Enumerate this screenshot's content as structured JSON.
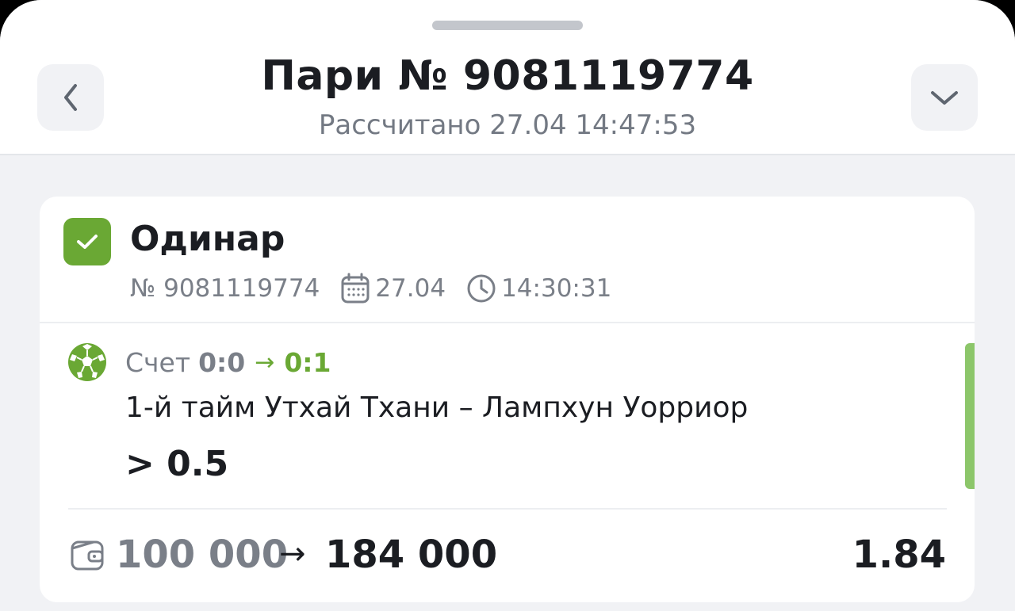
{
  "header": {
    "title": "Пари № 9081119774",
    "subtitle": "Рассчитано 27.04 14:47:53"
  },
  "bet": {
    "type": "Одинар",
    "number": "№ 9081119774",
    "date": "27.04",
    "time": "14:30:31",
    "status_icon": "check-icon",
    "accent_color": "#6aa834"
  },
  "event": {
    "sport_icon": "soccer-ball-icon",
    "score_label": "Счет",
    "score_from": "0:0",
    "score_arrow": "→",
    "score_to": "0:1",
    "name": "1-й тайм Утхай Тхани – Лампхун Уорриор",
    "outcome": "> 0.5"
  },
  "summary": {
    "stake": "100 000",
    "arrow": "→",
    "payout": "184 000",
    "odds": "1.84"
  }
}
